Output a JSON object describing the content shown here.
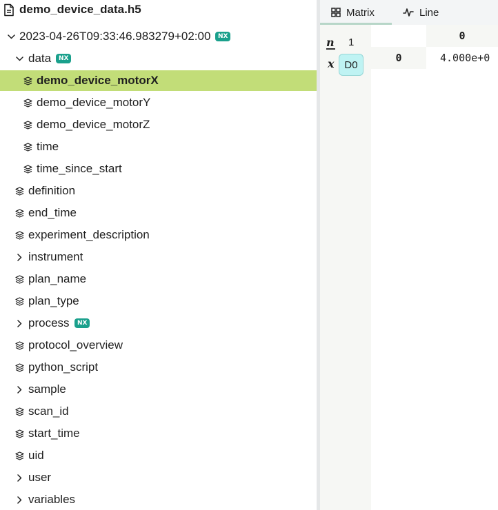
{
  "file": {
    "name": "demo_device_data.h5",
    "icon": "file-icon"
  },
  "tree": {
    "root": {
      "label": "2023-04-26T09:33:46.983279+02:00",
      "badge": "NX"
    },
    "data": {
      "label": "data",
      "badge": "NX"
    },
    "data_children": [
      {
        "label": "demo_device_motorX",
        "selected": true
      },
      {
        "label": "demo_device_motorY"
      },
      {
        "label": "demo_device_motorZ"
      },
      {
        "label": "time"
      },
      {
        "label": "time_since_start"
      }
    ],
    "entries": [
      {
        "label": "definition",
        "kind": "dataset"
      },
      {
        "label": "end_time",
        "kind": "dataset"
      },
      {
        "label": "experiment_description",
        "kind": "dataset"
      },
      {
        "label": "instrument",
        "kind": "group"
      },
      {
        "label": "plan_name",
        "kind": "dataset"
      },
      {
        "label": "plan_type",
        "kind": "dataset"
      },
      {
        "label": "process",
        "kind": "group",
        "badge": "NX"
      },
      {
        "label": "protocol_overview",
        "kind": "dataset"
      },
      {
        "label": "python_script",
        "kind": "dataset"
      },
      {
        "label": "sample",
        "kind": "group"
      },
      {
        "label": "scan_id",
        "kind": "dataset"
      },
      {
        "label": "start_time",
        "kind": "dataset"
      },
      {
        "label": "uid",
        "kind": "dataset"
      },
      {
        "label": "user",
        "kind": "group"
      },
      {
        "label": "variables",
        "kind": "group"
      }
    ]
  },
  "viewer": {
    "tabs": [
      {
        "label": "Matrix",
        "icon": "grid-icon",
        "active": true
      },
      {
        "label": "Line",
        "icon": "line-chart-icon"
      }
    ],
    "dims": {
      "n_symbol": "n",
      "n_value": "1",
      "x_symbol": "x",
      "slicer_label": "D0"
    },
    "matrix": {
      "col_header": "0",
      "row_header": "0",
      "cell": "4.000e+0"
    }
  },
  "colors": {
    "selected_row": "#c2dd78",
    "nx_badge": "#1aa08c",
    "slicer": "#bff3f3"
  }
}
